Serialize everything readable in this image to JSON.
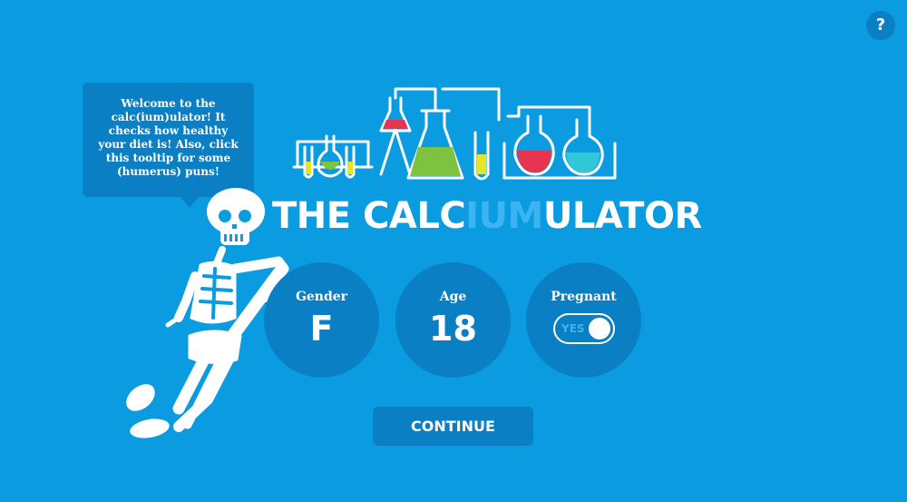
{
  "help": {
    "label": "?"
  },
  "tooltip": {
    "text": "Welcome to the calc(ium)ulator! It checks how healthy your diet is! Also, click this tooltip for some (humerus) puns!"
  },
  "title": {
    "part1": "THE CALC",
    "accent": "IUM",
    "part2": "ULATOR"
  },
  "fields": {
    "gender": {
      "label": "Gender",
      "value": "F"
    },
    "age": {
      "label": "Age",
      "value": "18"
    },
    "pregnant": {
      "label": "Pregnant",
      "toggle_text": "YES"
    }
  },
  "continue": {
    "label": "CONTINUE"
  },
  "colors": {
    "background": "#0a9be0",
    "panel": "#0a7fc4",
    "accent": "#3db4f2",
    "flask_red": "#e8354f",
    "flask_green": "#7fc241",
    "flask_yellow": "#e6e621",
    "flask_teal": "#30c7d8"
  }
}
